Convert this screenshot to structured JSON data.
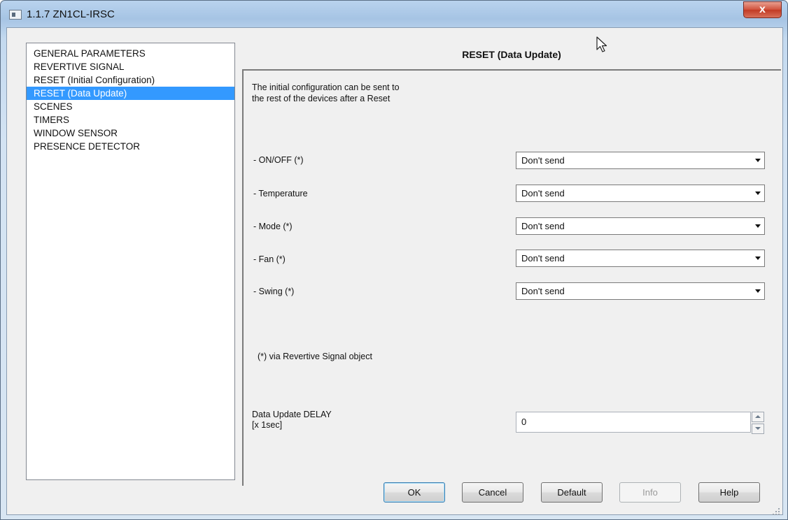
{
  "window": {
    "title": "1.1.7 ZN1CL-IRSC",
    "close_label": "x"
  },
  "sidebar": {
    "items": [
      {
        "label": "GENERAL PARAMETERS",
        "selected": false
      },
      {
        "label": "REVERTIVE SIGNAL",
        "selected": false
      },
      {
        "label": "RESET (Initial Configuration)",
        "selected": false
      },
      {
        "label": "RESET (Data Update)",
        "selected": true
      },
      {
        "label": "SCENES",
        "selected": false
      },
      {
        "label": "TIMERS",
        "selected": false
      },
      {
        "label": "WINDOW SENSOR",
        "selected": false
      },
      {
        "label": "PRESENCE DETECTOR",
        "selected": false
      }
    ]
  },
  "panel": {
    "title": "RESET (Data Update)",
    "description_line1": "The initial configuration can be sent to",
    "description_line2": "the rest of the devices after a Reset",
    "rows": [
      {
        "label": "- ON/OFF (*)",
        "value": "Don't send"
      },
      {
        "label": "- Temperature",
        "value": "Don't send"
      },
      {
        "label": "- Mode (*)",
        "value": "Don't send"
      },
      {
        "label": "- Fan (*)",
        "value": "Don't send"
      },
      {
        "label": "- Swing (*)",
        "value": "Don't send"
      }
    ],
    "note": "(*) via Revertive Signal object",
    "delay_label_line1": "Data Update DELAY",
    "delay_label_line2": "[x 1sec]",
    "delay_value": "0"
  },
  "buttons": {
    "ok": "OK",
    "cancel": "Cancel",
    "default": "Default",
    "info": "Info",
    "help": "Help"
  },
  "colors": {
    "selection": "#3399ff",
    "close_button": "#c23a24"
  }
}
